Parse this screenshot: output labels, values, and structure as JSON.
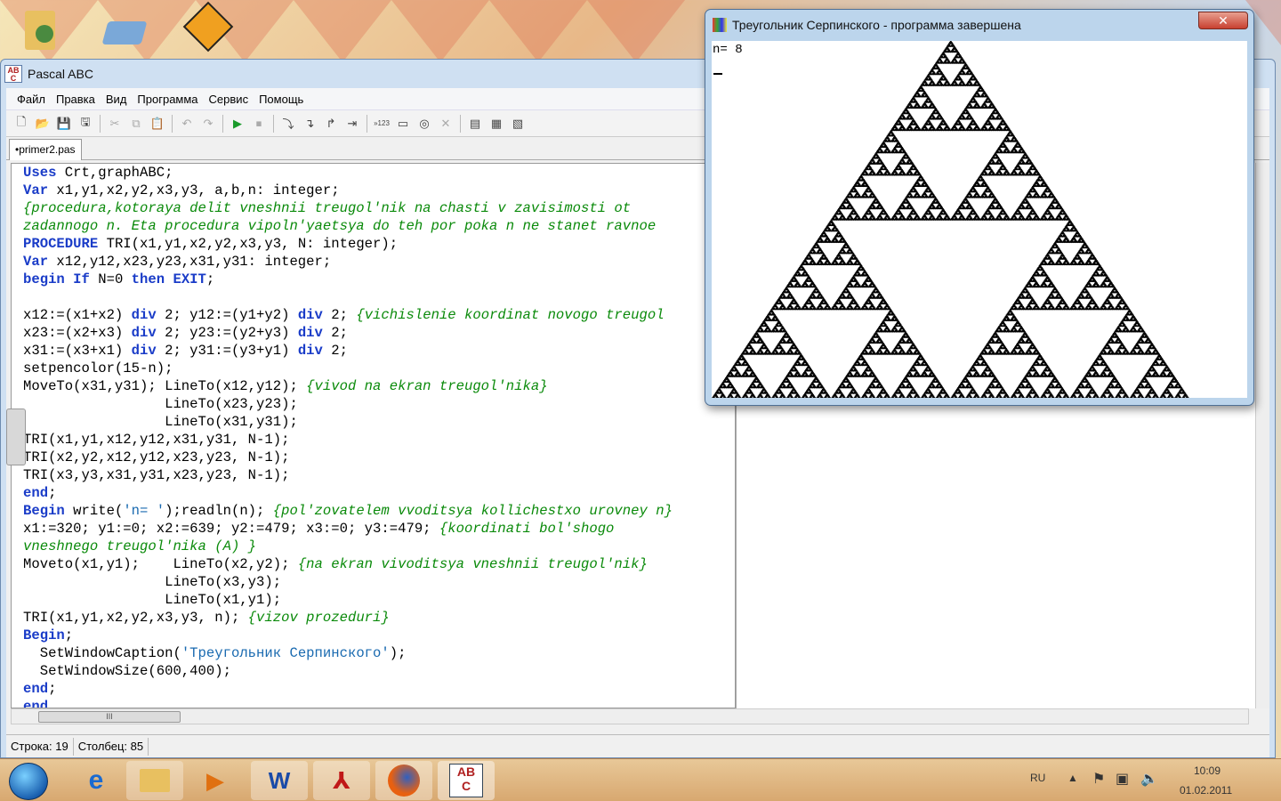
{
  "main_window": {
    "title": "Pascal ABC"
  },
  "menu": [
    "Файл",
    "Правка",
    "Вид",
    "Программа",
    "Сервис",
    "Помощь"
  ],
  "file_tab": "•primer2.pas",
  "code": [
    [
      [
        "kw",
        "Uses"
      ],
      [
        "t",
        " Crt,graphABC;"
      ]
    ],
    [
      [
        "kw",
        "Var"
      ],
      [
        "t",
        " x1,y1,x2,y2,x3,y3, a,b,n: integer;"
      ]
    ],
    [
      [
        "cm",
        "{procedura,kotoraya delit vneshnii treugol'nik na chasti v zavisimosti ot"
      ]
    ],
    [
      [
        "cm",
        "zadannogo n. Eta procedura vipoln'yaetsya do teh por poka n ne stanet ravnoe"
      ]
    ],
    [
      [
        "kw",
        "PROCEDURE"
      ],
      [
        "t",
        " TRI(x1,y1,x2,y2,x3,y3, N: integer);"
      ]
    ],
    [
      [
        "kw",
        "Var"
      ],
      [
        "t",
        " x12,y12,x23,y23,x31,y31: integer;"
      ]
    ],
    [
      [
        "kw",
        "begin"
      ],
      [
        "t",
        " "
      ],
      [
        "kw",
        "If"
      ],
      [
        "t",
        " N=0 "
      ],
      [
        "kw",
        "then"
      ],
      [
        "t",
        " "
      ],
      [
        "kw",
        "EXIT"
      ],
      [
        "t",
        ";"
      ]
    ],
    [
      [
        "t",
        ""
      ]
    ],
    [
      [
        "t",
        "x12:=(x1+x2) "
      ],
      [
        "kw",
        "div"
      ],
      [
        "t",
        " 2; y12:=(y1+y2) "
      ],
      [
        "kw",
        "div"
      ],
      [
        "t",
        " 2; "
      ],
      [
        "cm",
        "{vichislenie koordinat novogo treugol"
      ]
    ],
    [
      [
        "t",
        "x23:=(x2+x3) "
      ],
      [
        "kw",
        "div"
      ],
      [
        "t",
        " 2; y23:=(y2+y3) "
      ],
      [
        "kw",
        "div"
      ],
      [
        "t",
        " 2;"
      ]
    ],
    [
      [
        "t",
        "x31:=(x3+x1) "
      ],
      [
        "kw",
        "div"
      ],
      [
        "t",
        " 2; y31:=(y3+y1) "
      ],
      [
        "kw",
        "div"
      ],
      [
        "t",
        " 2;"
      ]
    ],
    [
      [
        "t",
        "setpencolor(15-n);"
      ]
    ],
    [
      [
        "t",
        "MoveTo(x31,y31); LineTo(x12,y12); "
      ],
      [
        "cm",
        "{vivod na ekran treugol'nika}"
      ]
    ],
    [
      [
        "t",
        "                 LineTo(x23,y23);"
      ]
    ],
    [
      [
        "t",
        "                 LineTo(x31,y31);"
      ]
    ],
    [
      [
        "t",
        "TRI(x1,y1,x12,y12,x31,y31, N-1);"
      ]
    ],
    [
      [
        "t",
        "TRI(x2,y2,x12,y12,x23,y23, N-1);"
      ]
    ],
    [
      [
        "t",
        "TRI(x3,y3,x31,y31,x23,y23, N-1);"
      ]
    ],
    [
      [
        "kw",
        "end"
      ],
      [
        "t",
        ";"
      ]
    ],
    [
      [
        "kw",
        "Begin"
      ],
      [
        "t",
        " write("
      ],
      [
        "st",
        "'n= '"
      ],
      [
        "t",
        ");readln(n); "
      ],
      [
        "cm",
        "{pol'zovatelem vvoditsya kollichestxo urovney n}"
      ]
    ],
    [
      [
        "t",
        "x1:=320; y1:=0; x2:=639; y2:=479; x3:=0; y3:=479; "
      ],
      [
        "cm",
        "{koordinati bol'shogo"
      ]
    ],
    [
      [
        "cm",
        "vneshnego treugol'nika (A) }"
      ]
    ],
    [
      [
        "t",
        "Moveto(x1,y1);    LineTo(x2,y2); "
      ],
      [
        "cm",
        "{na ekran vivoditsya vneshnii treugol'nik}"
      ]
    ],
    [
      [
        "t",
        "                 LineTo(x3,y3);"
      ]
    ],
    [
      [
        "t",
        "                 LineTo(x1,y1);"
      ]
    ],
    [
      [
        "t",
        "TRI(x1,y1,x2,y2,x3,y3, n); "
      ],
      [
        "cm",
        "{vizov prozeduri}"
      ]
    ],
    [
      [
        "kw",
        "Begin"
      ],
      [
        "t",
        ";"
      ]
    ],
    [
      [
        "t",
        "  SetWindowCaption("
      ],
      [
        "st",
        "'Треугольник Серпинского'"
      ],
      [
        "t",
        ");"
      ]
    ],
    [
      [
        "t",
        "  SetWindowSize(600,400);"
      ]
    ],
    [
      [
        "kw",
        "end"
      ],
      [
        "t",
        ";"
      ]
    ],
    [
      [
        "kw",
        "end"
      ],
      [
        "t",
        "."
      ]
    ]
  ],
  "status": {
    "row": "Строка: 19",
    "col": "Столбец: 85"
  },
  "graph_window": {
    "title": "Треугольник Серпинского - программа завершена",
    "console": "n= 8",
    "sierpinski_levels": 8
  },
  "tray": {
    "lang": "RU",
    "time": "10:09",
    "date": "01.02.2011"
  },
  "colors": {
    "keyword": "#1a3cc8",
    "comment": "#0a8a0a",
    "string": "#1a6ab0"
  }
}
